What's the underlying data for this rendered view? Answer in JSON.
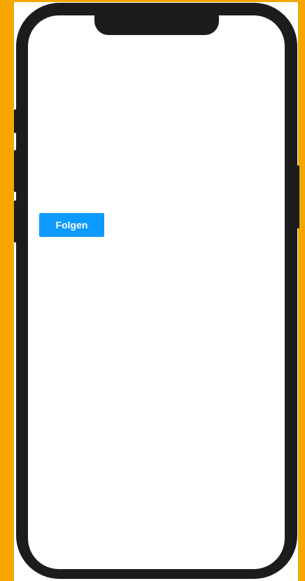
{
  "follow_button": {
    "label": "Folgen",
    "color": "#0d9aff"
  },
  "colors": {
    "background": "#f5a700",
    "phone_frame": "#1c1c1c",
    "screen": "#ffffff"
  }
}
